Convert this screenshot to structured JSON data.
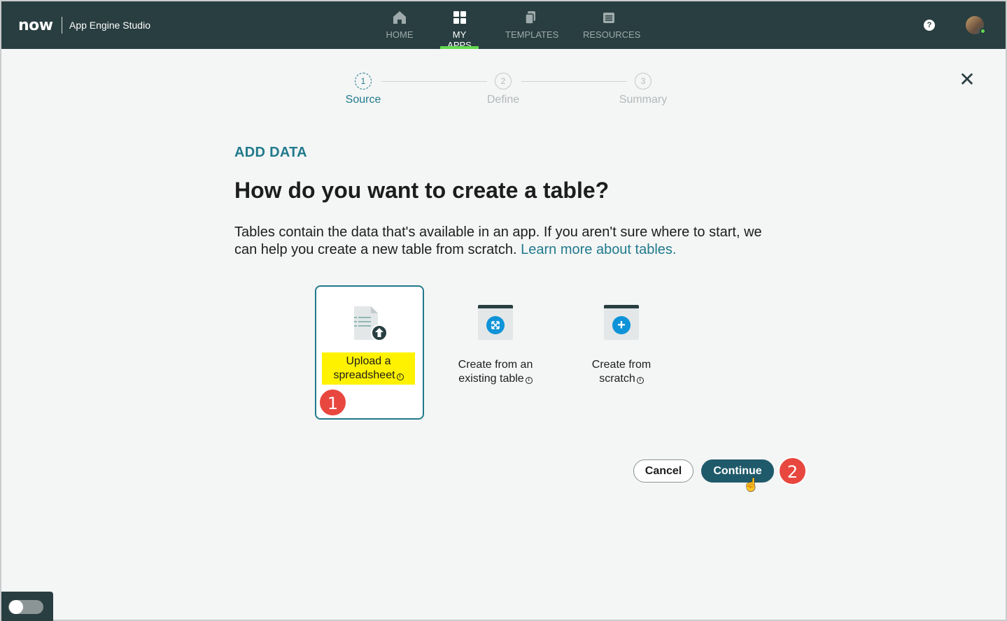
{
  "header": {
    "logo": "now",
    "app_name": "App Engine Studio",
    "nav": [
      {
        "label": "HOME",
        "icon": "home-icon",
        "active": false
      },
      {
        "label": "MY APPS",
        "icon": "grid-icon",
        "active": true
      },
      {
        "label": "TEMPLATES",
        "icon": "templates-icon",
        "active": false
      },
      {
        "label": "RESOURCES",
        "icon": "resources-icon",
        "active": false
      }
    ],
    "help": "?"
  },
  "stepper": {
    "steps": [
      {
        "num": "1",
        "label": "Source",
        "active": true
      },
      {
        "num": "2",
        "label": "Define",
        "active": false
      },
      {
        "num": "3",
        "label": "Summary",
        "active": false
      }
    ]
  },
  "content": {
    "eyebrow": "ADD DATA",
    "heading": "How do you want to create a table?",
    "description": "Tables contain the data that's available in an app. If you aren't sure where to start, we can help you create a new table from scratch.",
    "learn_more": "Learn more about tables."
  },
  "cards": [
    {
      "label": "Upload a spreadsheet",
      "icon": "spreadsheet-upload-icon",
      "selected": true
    },
    {
      "label": "Create from an existing table",
      "icon": "table-expand-icon",
      "selected": false
    },
    {
      "label": "Create from scratch",
      "icon": "table-plus-icon",
      "selected": false
    }
  ],
  "info_glyph": "i",
  "buttons": {
    "cancel": "Cancel",
    "continue": "Continue"
  },
  "annotations": [
    "1",
    "2"
  ],
  "colors": {
    "accent": "#1f7a8c",
    "header_bg": "#293e40",
    "highlight": "#fff200",
    "badge": "#e8473f",
    "primary_button": "#1f5a6b"
  }
}
